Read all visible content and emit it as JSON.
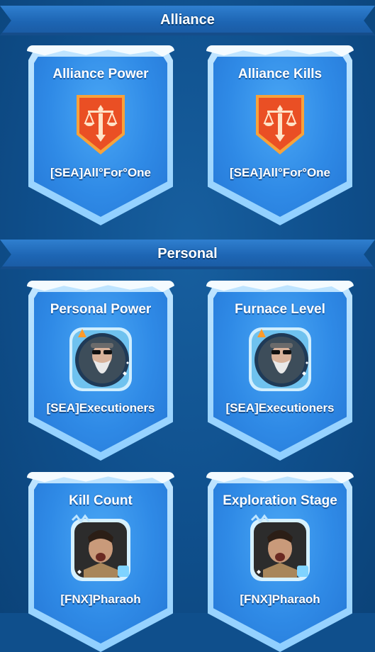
{
  "sections": {
    "alliance": {
      "title": "Alliance"
    },
    "personal": {
      "title": "Personal"
    }
  },
  "cards": [
    {
      "title": "Alliance Power",
      "name": "[SEA]All°For°One",
      "icon": "alliance-shield-icon"
    },
    {
      "title": "Alliance Kills",
      "name": "[SEA]All°For°One",
      "icon": "alliance-shield-icon"
    },
    {
      "title": "Personal Power",
      "name": "[SEA]Executioners",
      "icon": "player-portrait"
    },
    {
      "title": "Furnace Level",
      "name": "[SEA]Executioners",
      "icon": "player-portrait"
    },
    {
      "title": "Kill Count",
      "name": "[FNX]Pharaoh",
      "icon": "player-portrait"
    },
    {
      "title": "Exploration Stage",
      "name": "[FNX]Pharaoh",
      "icon": "player-portrait"
    }
  ],
  "colors": {
    "background": "#0f4f8c",
    "card_blue": "#2f8ae6",
    "shield_orange": "#f06a2a"
  }
}
